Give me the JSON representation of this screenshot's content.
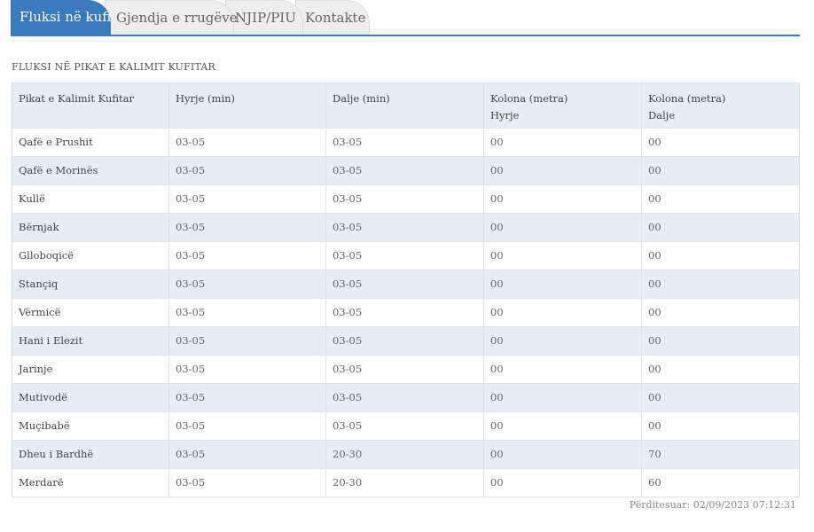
{
  "tabs": [
    {
      "label": "Fluksi në kufi",
      "active": true
    },
    {
      "label": "Gjendja e rrugëve",
      "active": false
    },
    {
      "label": "NJIP/PIU",
      "active": false
    },
    {
      "label": "Kontakte",
      "active": false
    }
  ],
  "section_title": "FLUKSI NË PIKAT E KALIMIT KUFITAR",
  "table": {
    "headers": [
      {
        "line1": "Pikat e Kalimit Kufitar",
        "line2": ""
      },
      {
        "line1": "Hyrje (min)",
        "line2": ""
      },
      {
        "line1": "Dalje (min)",
        "line2": ""
      },
      {
        "line1": "Kolona (metra)",
        "line2": "Hyrje"
      },
      {
        "line1": "Kolona (metra)",
        "line2": "Dalje"
      }
    ],
    "rows": [
      [
        "Qafë e Prushit",
        "03-05",
        "03-05",
        "00",
        "00"
      ],
      [
        "Qafë e Morinës",
        "03-05",
        "03-05",
        "00",
        "00"
      ],
      [
        "Kullë",
        "03-05",
        "03-05",
        "00",
        "00"
      ],
      [
        "Bërnjak",
        "03-05",
        "03-05",
        "00",
        "00"
      ],
      [
        "Glloboqicë",
        "03-05",
        "03-05",
        "00",
        "00"
      ],
      [
        "Stançiq",
        "03-05",
        "03-05",
        "00",
        "00"
      ],
      [
        "Vërmicë",
        "03-05",
        "03-05",
        "00",
        "00"
      ],
      [
        "Hani i Elezit",
        "03-05",
        "03-05",
        "00",
        "00"
      ],
      [
        "Jarinje",
        "03-05",
        "03-05",
        "00",
        "00"
      ],
      [
        "Mutivodë",
        "03-05",
        "03-05",
        "00",
        "00"
      ],
      [
        "Muçibabë",
        "03-05",
        "03-05",
        "00",
        "00"
      ],
      [
        "Dheu i Bardhë",
        "03-05",
        "20-30",
        "00",
        "70"
      ],
      [
        "Merdarë",
        "03-05",
        "20-30",
        "00",
        "60"
      ]
    ]
  },
  "updated_text": "Përditesuar: 02/09/2023 07:12:31",
  "colors": {
    "accent": "#3a7abf",
    "row_stripe": "#e6eef6"
  }
}
